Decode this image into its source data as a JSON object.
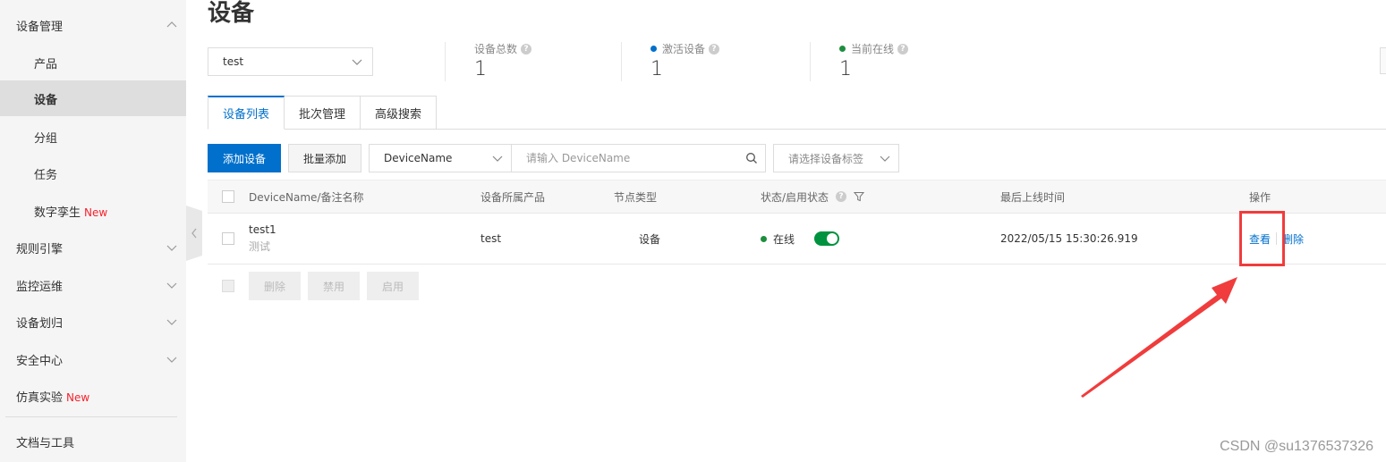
{
  "sidebar": {
    "items": [
      {
        "label": "设备管理",
        "expanded": true
      },
      {
        "label": "产品"
      },
      {
        "label": "设备",
        "active": true
      },
      {
        "label": "分组"
      },
      {
        "label": "任务"
      },
      {
        "label": "数字孪生",
        "badge": "New"
      },
      {
        "label": "规则引擎"
      },
      {
        "label": "监控运维"
      },
      {
        "label": "设备划归"
      },
      {
        "label": "安全中心"
      },
      {
        "label": "仿真实验",
        "badge": "New"
      },
      {
        "label": "文档与工具"
      }
    ]
  },
  "page": {
    "title": "设备",
    "product_select": "test"
  },
  "stats": [
    {
      "label": "设备总数",
      "value": "1"
    },
    {
      "label": "激活设备",
      "value": "1",
      "dot_color": "#0070cc"
    },
    {
      "label": "当前在线",
      "value": "1",
      "dot_color": "#1e8e3e"
    }
  ],
  "tabs": [
    {
      "label": "设备列表",
      "active": true
    },
    {
      "label": "批次管理"
    },
    {
      "label": "高级搜索"
    }
  ],
  "toolbar": {
    "add_device": "添加设备",
    "batch_add": "批量添加",
    "field_select": "DeviceName",
    "search_placeholder": "请输入 DeviceName",
    "tag_select_placeholder": "请选择设备标签"
  },
  "table": {
    "columns": [
      "DeviceName/备注名称",
      "设备所属产品",
      "节点类型",
      "状态/启用状态",
      "最后上线时间",
      "操作"
    ],
    "rows": [
      {
        "name": "test1",
        "remark": "测试",
        "product": "test",
        "node_type": "设备",
        "status": "在线",
        "enabled": true,
        "last_online": "2022/05/15 15:30:26.919",
        "actions": [
          "查看",
          "删除"
        ]
      }
    ]
  },
  "bulk_actions": [
    "删除",
    "禁用",
    "启用"
  ],
  "colors": {
    "primary": "#0070cc",
    "online": "#1e8e3e",
    "toggle_on": "#00923f",
    "new_badge": "#f5222d",
    "annotation": "#f03c3c"
  },
  "watermark": "CSDN @su1376537326"
}
